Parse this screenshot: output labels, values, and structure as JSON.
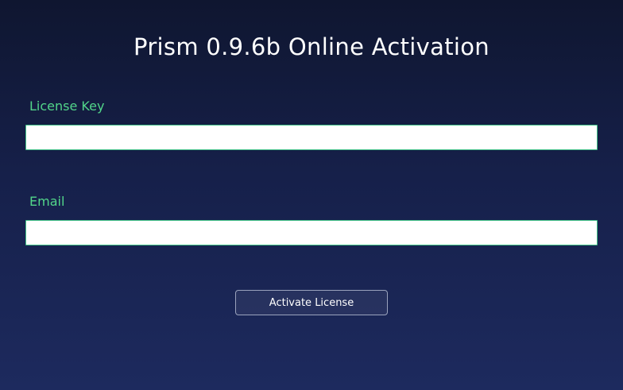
{
  "window": {
    "title": "Prism 0.9.6b Online Activation"
  },
  "form": {
    "license_key": {
      "label": "License Key",
      "value": "",
      "placeholder": ""
    },
    "email": {
      "label": "Email",
      "value": "",
      "placeholder": ""
    },
    "activate_label": "Activate License"
  },
  "colors": {
    "background_top": "#0f1630",
    "background_bottom": "#1d2a5e",
    "label_accent": "#52d68a",
    "input_border": "#3fbf86"
  }
}
